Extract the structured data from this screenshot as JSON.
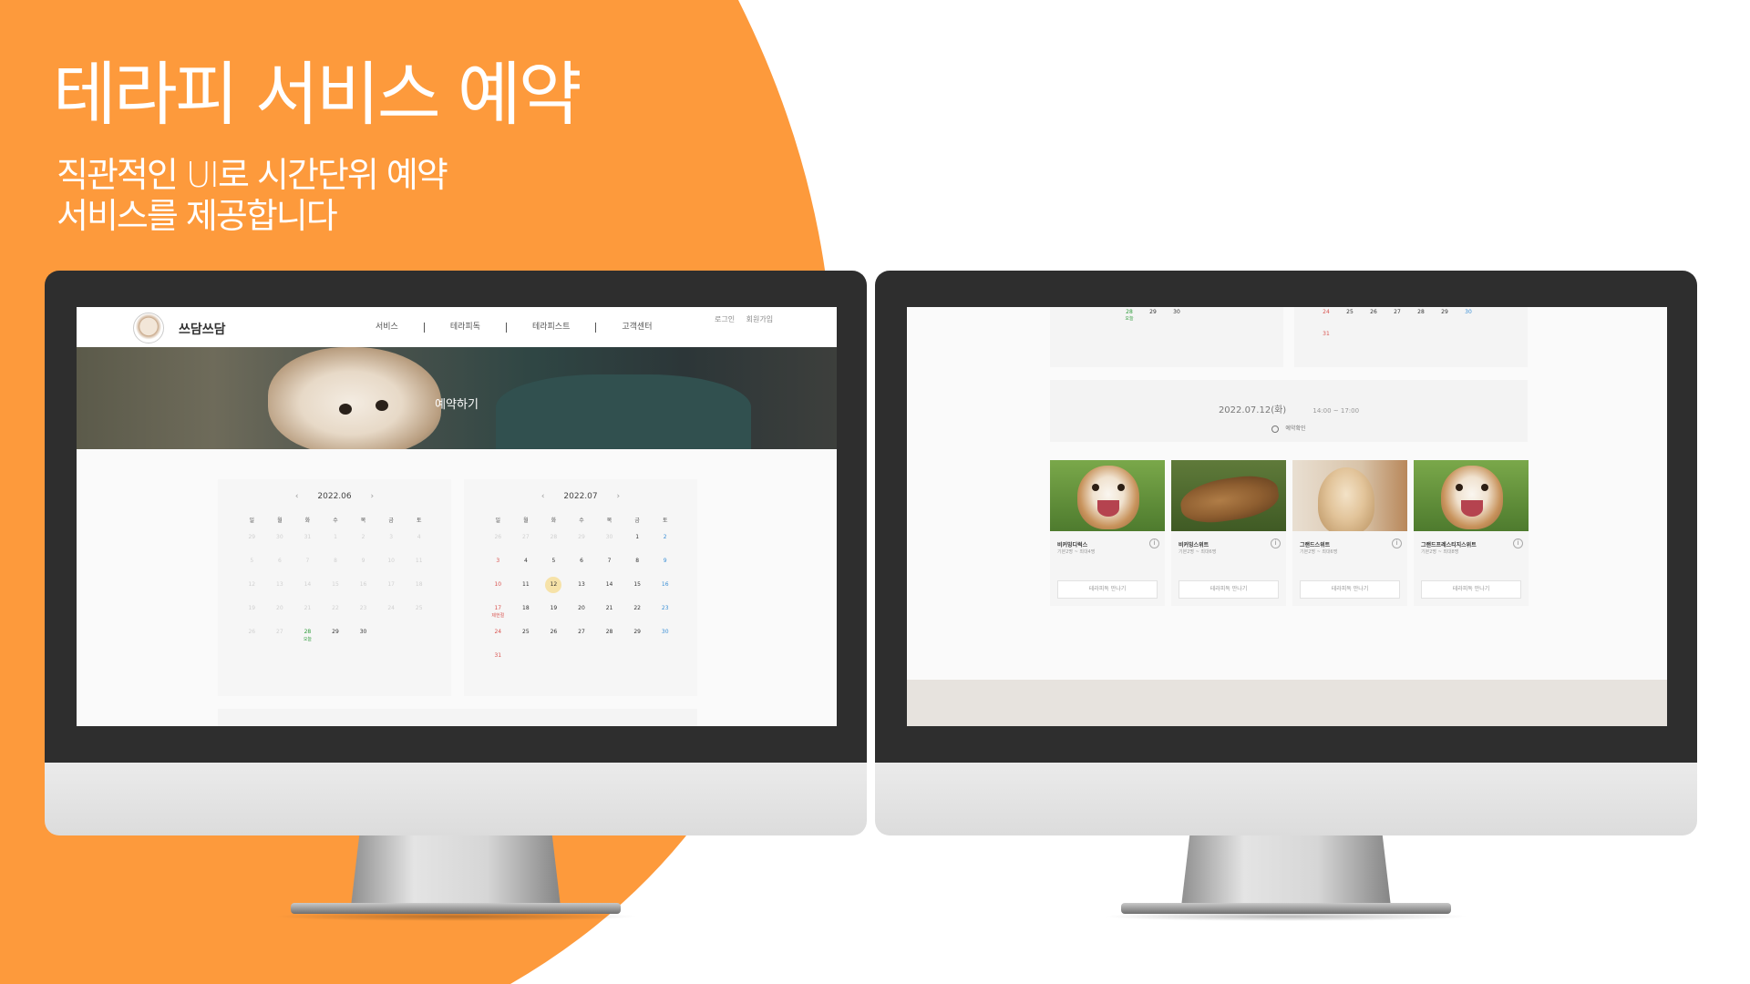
{
  "headline": "테라피 서비스 예약",
  "subtitle_lines": [
    "직관적인 UI로 시간단위 예약",
    "서비스를 제공합니다"
  ],
  "colors": {
    "accent": "#FD9A3C",
    "background": "#FFFFFF"
  },
  "left_screen": {
    "site_name": "쓰담쓰담",
    "nav": [
      "서비스",
      "테라피독",
      "테라피스트",
      "고객센터"
    ],
    "auth": {
      "login": "로그인",
      "signup": "회원가입"
    },
    "hero_title": "예약하기",
    "weekdays": [
      "일",
      "월",
      "화",
      "수",
      "목",
      "금",
      "토"
    ],
    "calendars": [
      {
        "month": "2022.06",
        "prev_icon": "chevron-left-icon",
        "next_icon": "chevron-right-icon",
        "weeks": [
          [
            "29",
            "30",
            "31",
            "1",
            "2",
            "3",
            "4"
          ],
          [
            "5",
            "6",
            "7",
            "8",
            "9",
            "10",
            "11"
          ],
          [
            "12",
            "13",
            "14",
            "15",
            "16",
            "17",
            "18"
          ],
          [
            "19",
            "20",
            "21",
            "22",
            "23",
            "24",
            "25"
          ],
          [
            "26",
            "27",
            "28",
            "29",
            "30",
            "",
            ""
          ]
        ],
        "today": "28",
        "today_label": "오늘"
      },
      {
        "month": "2022.07",
        "prev_icon": "chevron-left-icon",
        "next_icon": "chevron-right-icon",
        "weeks": [
          [
            "26",
            "27",
            "28",
            "29",
            "30",
            "1",
            "2"
          ],
          [
            "3",
            "4",
            "5",
            "6",
            "7",
            "8",
            "9"
          ],
          [
            "10",
            "11",
            "12",
            "13",
            "14",
            "15",
            "16"
          ],
          [
            "17",
            "18",
            "19",
            "20",
            "21",
            "22",
            "23"
          ],
          [
            "24",
            "25",
            "26",
            "27",
            "28",
            "29",
            "30"
          ],
          [
            "31",
            "",
            "",
            "",
            "",
            "",
            ""
          ]
        ],
        "selected": "12",
        "holiday": "17",
        "holiday_label": "제헌절"
      }
    ]
  },
  "right_screen": {
    "top_left_row": [
      "",
      "",
      "28",
      "29",
      "30"
    ],
    "top_left_today_label": "오늘",
    "top_right_rows": [
      [
        "24",
        "25",
        "26",
        "27",
        "28",
        "29",
        "30"
      ],
      [
        "31"
      ]
    ],
    "summary": {
      "date": "2022.07.12(화)",
      "time": "14:00 ~ 17:00",
      "confirm": "예약확인"
    },
    "cards": [
      {
        "name": "비커밍디럭스",
        "meta": "기본2명 ~ 최대4명",
        "button": "테라피독 만나기"
      },
      {
        "name": "비커밍스위트",
        "meta": "기본2명 ~ 최대6명",
        "button": "테라피독 만나기"
      },
      {
        "name": "그랜드스위트",
        "meta": "기본2명 ~ 최대6명",
        "button": "테라피독 만나기"
      },
      {
        "name": "그랜드프레스티지스위트",
        "meta": "기본2명 ~ 최대8명",
        "button": "테라피독 만나기"
      }
    ]
  }
}
